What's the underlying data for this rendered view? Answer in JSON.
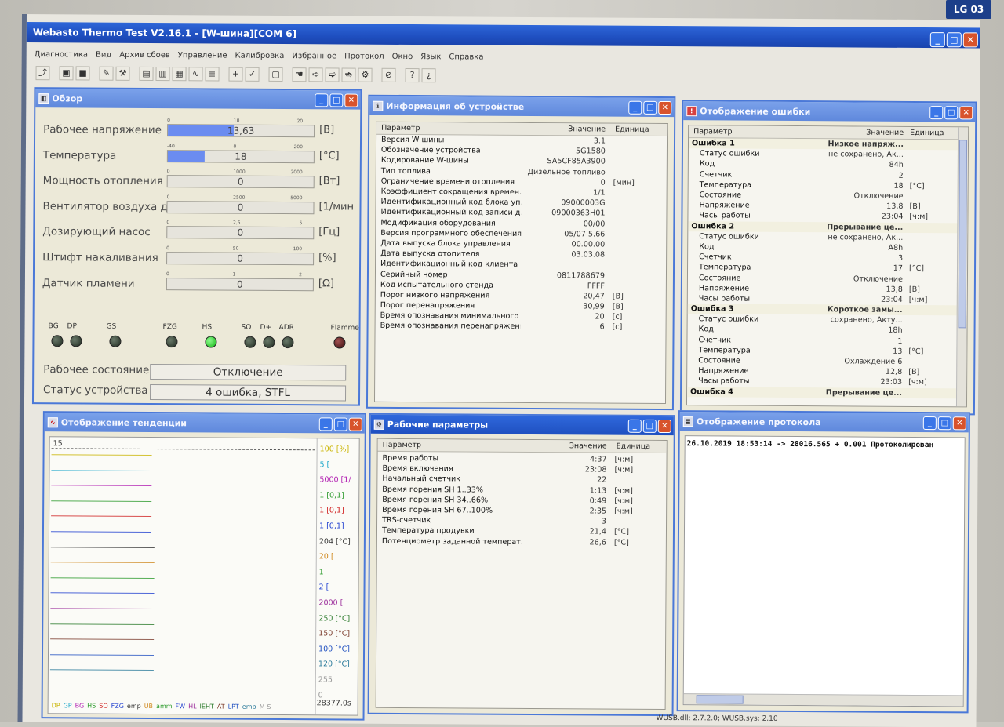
{
  "app": {
    "title": "Webasto Thermo Test V2.16.1 - [W-шина][COM 6]",
    "menu": [
      "Диагностика",
      "Вид",
      "Архив сбоев",
      "Управление",
      "Калибровка",
      "Избранное",
      "Протокол",
      "Окно",
      "Язык",
      "Справка"
    ]
  },
  "overview": {
    "title": "Обзор",
    "gauges": [
      {
        "label": "Рабочее напряжение",
        "value": "13,63",
        "unit": "[В]",
        "fill": 0.45,
        "scale": [
          "0",
          "10",
          "20"
        ]
      },
      {
        "label": "Температура",
        "value": "18",
        "unit": "[°C]",
        "fill": 0.25,
        "scale": [
          "-40",
          "0",
          "200"
        ]
      },
      {
        "label": "Мощность отопления",
        "value": "0",
        "unit": "[Вт]",
        "fill": 0,
        "scale": [
          "0",
          "1000",
          "2000"
        ]
      },
      {
        "label": "Вентилятор воздуха д",
        "value": "0",
        "unit": "[1/мин",
        "fill": 0,
        "scale": [
          "0",
          "2500",
          "5000"
        ]
      },
      {
        "label": "Дозирующий насос",
        "value": "0",
        "unit": "[Гц]",
        "fill": 0,
        "scale": [
          "0",
          "2,5",
          "5"
        ]
      },
      {
        "label": "Штифт накаливания",
        "value": "0",
        "unit": "[%]",
        "fill": 0,
        "scale": [
          "0",
          "50",
          "100"
        ]
      },
      {
        "label": "Датчик пламени",
        "value": "0",
        "unit": "[Ω]",
        "fill": 0,
        "scale": [
          "0",
          "1",
          "2"
        ]
      }
    ],
    "leds": [
      {
        "label": "BG",
        "state": "off"
      },
      {
        "label": "DP",
        "state": "off"
      },
      {
        "label": "GS",
        "state": "off"
      },
      {
        "label": "FZG",
        "state": "off"
      },
      {
        "label": "HS",
        "state": "on"
      },
      {
        "label": "SO",
        "state": "off"
      },
      {
        "label": "D+",
        "state": "off"
      },
      {
        "label": "ADR",
        "state": "off"
      },
      {
        "label": "Flamme",
        "state": "red"
      }
    ],
    "work_state_label": "Рабочее состояние",
    "work_state_value": "Отключение",
    "device_status_label": "Статус устройства",
    "device_status_value": "4 ошибка, STFL"
  },
  "device_info": {
    "title": "Информация об устройстве",
    "headers": [
      "Параметр",
      "Значение",
      "Единица"
    ],
    "rows": [
      [
        "Версия W-шины",
        "3.1",
        ""
      ],
      [
        "Обозначение устройства",
        "5G1580",
        ""
      ],
      [
        "Кодирование W-шины",
        "SA5CF85A3900",
        ""
      ],
      [
        "Тип топлива",
        "Дизельное топливо",
        ""
      ],
      [
        "Ограничение времени отопления",
        "0",
        "[мин]"
      ],
      [
        "Коэффициент сокращения времен...",
        "1/1",
        ""
      ],
      [
        "Идентификационный код блока уп...",
        "09000003G",
        ""
      ],
      [
        "Идентификационный код записи д...",
        "09000363H01",
        ""
      ],
      [
        "Модификация оборудования",
        "00/00",
        ""
      ],
      [
        "Версия программного обеспечения",
        "05/07 5.66",
        ""
      ],
      [
        "Дата выпуска блока управления",
        "00.00.00",
        ""
      ],
      [
        "Дата выпуска отопителя",
        "03.03.08",
        ""
      ],
      [
        "Идентификационный код клиента",
        "",
        ""
      ],
      [
        "Серийный номер",
        "0811788679",
        ""
      ],
      [
        "Код испытательного стенда",
        "FFFF",
        ""
      ],
      [
        "Порог низкого напряжения",
        "20,47",
        "[В]"
      ],
      [
        "Порог перенапряжения",
        "30,99",
        "[В]"
      ],
      [
        "Время опознавания минимального ...",
        "20",
        "[с]"
      ],
      [
        "Время опознавания перенапряжения",
        "6",
        "[с]"
      ]
    ]
  },
  "errors": {
    "title": "Отображение ошибки",
    "headers": [
      "Параметр",
      "Значение",
      "Единица"
    ],
    "rows": [
      {
        "p": "Ошибка 1",
        "v": "Низкое напряж...",
        "u": "",
        "head": true
      },
      {
        "p": "Статус ошибки",
        "v": "не сохранено, Ак...",
        "u": ""
      },
      {
        "p": "Код",
        "v": "84h",
        "u": ""
      },
      {
        "p": "Счетчик",
        "v": "2",
        "u": ""
      },
      {
        "p": "Температура",
        "v": "18",
        "u": "[°C]"
      },
      {
        "p": "Состояние",
        "v": "Отключение",
        "u": ""
      },
      {
        "p": "Напряжение",
        "v": "13,8",
        "u": "[В]"
      },
      {
        "p": "Часы работы",
        "v": "23:04",
        "u": "[ч:м]"
      },
      {
        "p": "Ошибка 2",
        "v": "Прерывание це...",
        "u": "",
        "head": true
      },
      {
        "p": "Статус ошибки",
        "v": "не сохранено, Ак...",
        "u": ""
      },
      {
        "p": "Код",
        "v": "A8h",
        "u": ""
      },
      {
        "p": "Счетчик",
        "v": "3",
        "u": ""
      },
      {
        "p": "Температура",
        "v": "17",
        "u": "[°C]"
      },
      {
        "p": "Состояние",
        "v": "Отключение",
        "u": ""
      },
      {
        "p": "Напряжение",
        "v": "13,8",
        "u": "[В]"
      },
      {
        "p": "Часы работы",
        "v": "23:04",
        "u": "[ч:м]"
      },
      {
        "p": "Ошибка 3",
        "v": "Короткое замы...",
        "u": "",
        "head": true
      },
      {
        "p": "Статус ошибки",
        "v": "сохранено, Акту...",
        "u": ""
      },
      {
        "p": "Код",
        "v": "18h",
        "u": ""
      },
      {
        "p": "Счетчик",
        "v": "1",
        "u": ""
      },
      {
        "p": "Температура",
        "v": "13",
        "u": "[°C]"
      },
      {
        "p": "Состояние",
        "v": "Охлаждение 6",
        "u": ""
      },
      {
        "p": "Напряжение",
        "v": "12,8",
        "u": "[В]"
      },
      {
        "p": "Часы работы",
        "v": "23:03",
        "u": "[ч:м]"
      },
      {
        "p": "Ошибка 4",
        "v": "Прерывание це...",
        "u": "",
        "head": true
      }
    ]
  },
  "trend": {
    "title": "Отображение тенденции",
    "top_value": "15",
    "scales": [
      {
        "text": "100 [%]",
        "color": "#c9b400"
      },
      {
        "text": "5 [",
        "color": "#1aa6c9"
      },
      {
        "text": "5000 [1/",
        "color": "#b01ab0"
      },
      {
        "text": "1 [0,1]",
        "color": "#2b9a2b"
      },
      {
        "text": "1 [0,1]",
        "color": "#d02020"
      },
      {
        "text": "1 [0,1]",
        "color": "#2040d0"
      },
      {
        "text": "204 [°C]",
        "color": "#333333"
      },
      {
        "text": "20 [",
        "color": "#d08a20"
      },
      {
        "text": "1",
        "color": "#2b9a2b"
      },
      {
        "text": "2 [",
        "color": "#2040d0"
      },
      {
        "text": "2000 [",
        "color": "#9a2a9a"
      },
      {
        "text": "250 [°C]",
        "color": "#2b7a2b"
      },
      {
        "text": "150 [°C]",
        "color": "#7a3a2a"
      },
      {
        "text": "100 [°C]",
        "color": "#2050c0"
      },
      {
        "text": "120 [°C]",
        "color": "#2a7a9a"
      },
      {
        "text": "255",
        "color": "#999999"
      },
      {
        "text": "0",
        "color": "#999999"
      }
    ],
    "time": "28377.0s",
    "legend": [
      {
        "t": "DP",
        "c": "#c9b400"
      },
      {
        "t": "GP",
        "c": "#1aa6c9"
      },
      {
        "t": "BG",
        "c": "#b01ab0"
      },
      {
        "t": "HS",
        "c": "#2b9a2b"
      },
      {
        "t": "SO",
        "c": "#d02020"
      },
      {
        "t": "FZG",
        "c": "#2040d0"
      },
      {
        "t": "emp",
        "c": "#333333"
      },
      {
        "t": "UB",
        "c": "#d08a20"
      },
      {
        "t": "amm",
        "c": "#2b9a2b"
      },
      {
        "t": "FW",
        "c": "#2040d0"
      },
      {
        "t": "HL",
        "c": "#9a2a9a"
      },
      {
        "t": "IEHT",
        "c": "#2b7a2b"
      },
      {
        "t": "AT",
        "c": "#7a3a2a"
      },
      {
        "t": "LPT",
        "c": "#2050c0"
      },
      {
        "t": "emp",
        "c": "#2a7a9a"
      },
      {
        "t": "M-S",
        "c": "#999999"
      }
    ]
  },
  "work_params": {
    "title": "Рабочие параметры",
    "headers": [
      "Параметр",
      "Значение",
      "Единица"
    ],
    "rows": [
      [
        "Время работы",
        "4:37",
        "[ч:м]"
      ],
      [
        "Время включения",
        "23:08",
        "[ч:м]"
      ],
      [
        "Начальный счетчик",
        "22",
        ""
      ],
      [
        "Время горения SH 1..33%",
        "1:13",
        "[ч:м]"
      ],
      [
        "Время горения SH 34..66%",
        "0:49",
        "[ч:м]"
      ],
      [
        "Время горения SH 67..100%",
        "2:35",
        "[ч:м]"
      ],
      [
        "TRS-счетчик",
        "3",
        ""
      ],
      [
        "Температура продувки",
        "21,4",
        "[°C]"
      ],
      [
        "Потенциометр заданной температ...",
        "26,6",
        "[°C]"
      ]
    ]
  },
  "protocol": {
    "title": "Отображение протокола",
    "line": "26.10.2019 18:53:14 -> 28016.565 +  0.001 Протоколирован"
  },
  "status_bar": "WUSB.dll: 2.7.2.0; WUSB.sys: 2.10",
  "bezel_logo": "LG 03"
}
